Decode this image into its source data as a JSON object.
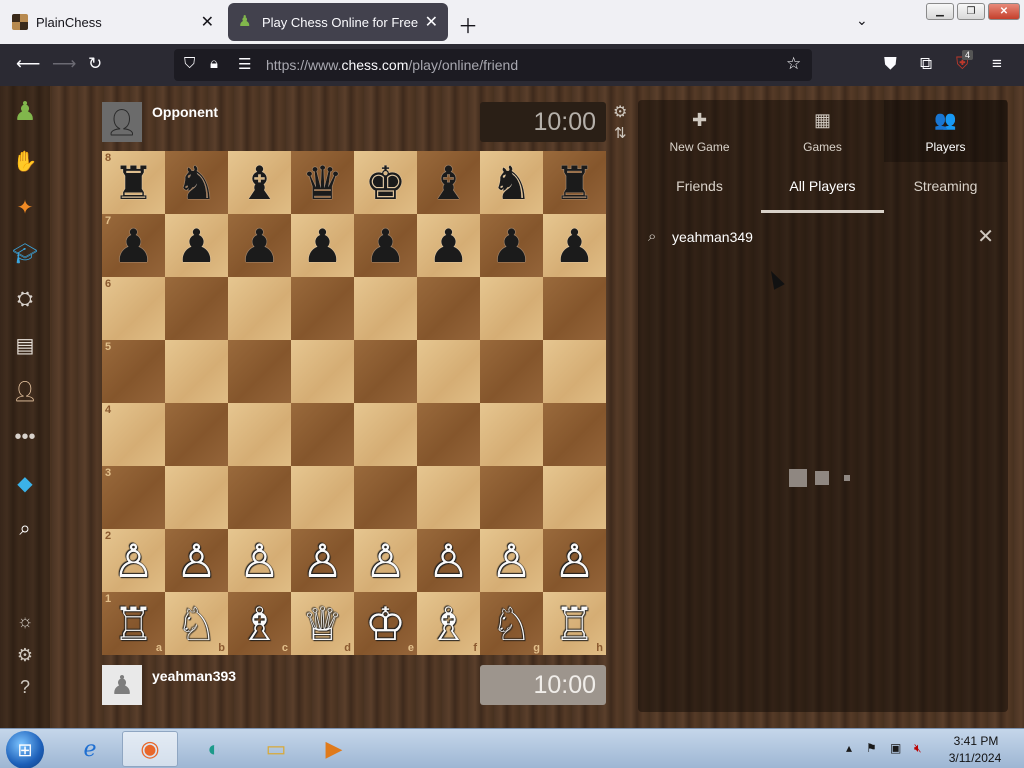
{
  "browser": {
    "tabs": [
      {
        "title": "PlainChess",
        "active": false
      },
      {
        "title": "Play Chess Online for Free with",
        "active": true
      }
    ],
    "url_prefix": "https://www.",
    "url_domain": "chess.com",
    "url_path": "/play/online/friend",
    "extension_badge": "4"
  },
  "game": {
    "opponent_name": "Opponent",
    "opponent_clock": "10:00",
    "player_name": "yeahman393",
    "player_clock": "10:00"
  },
  "board": {
    "ranks": [
      "8",
      "7",
      "6",
      "5",
      "4",
      "3",
      "2",
      "1"
    ],
    "files": [
      "a",
      "b",
      "c",
      "d",
      "e",
      "f",
      "g",
      "h"
    ],
    "rows": [
      [
        "♜",
        "♞",
        "♝",
        "♛",
        "♚",
        "♝",
        "♞",
        "♜"
      ],
      [
        "♟",
        "♟",
        "♟",
        "♟",
        "♟",
        "♟",
        "♟",
        "♟"
      ],
      [
        "",
        "",
        "",
        "",
        "",
        "",
        "",
        ""
      ],
      [
        "",
        "",
        "",
        "",
        "",
        "",
        "",
        ""
      ],
      [
        "",
        "",
        "",
        "",
        "",
        "",
        "",
        ""
      ],
      [
        "",
        "",
        "",
        "",
        "",
        "",
        "",
        ""
      ],
      [
        "♙",
        "♙",
        "♙",
        "♙",
        "♙",
        "♙",
        "♙",
        "♙"
      ],
      [
        "♖",
        "♘",
        "♗",
        "♕",
        "♔",
        "♗",
        "♘",
        "♖"
      ]
    ]
  },
  "panel": {
    "top_tabs": [
      {
        "label": "New Game",
        "icon": "✚"
      },
      {
        "label": "Games",
        "icon": "▦"
      },
      {
        "label": "Players",
        "icon": "👥"
      }
    ],
    "sub_tabs": [
      "Friends",
      "All Players",
      "Streaming"
    ],
    "active_sub_tab": "All Players",
    "search_value": "yeahman349"
  },
  "taskbar": {
    "time": "3:41 PM",
    "date": "3/11/2024"
  },
  "colors": {
    "active_tab": "#42414d",
    "navbar": "#2b2a33",
    "light_square": "#e6c690",
    "dark_square": "#9a6a3c"
  }
}
